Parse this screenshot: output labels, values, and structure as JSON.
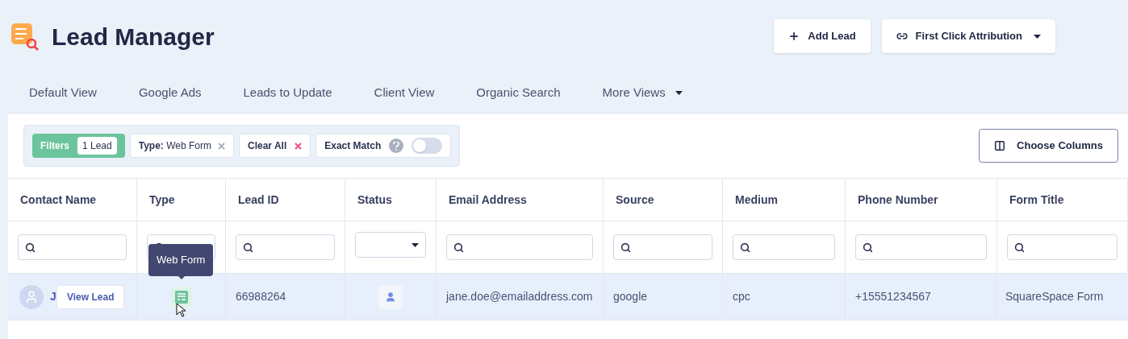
{
  "header": {
    "title": "Lead Manager",
    "buttons": [
      {
        "kind": "add",
        "label": "Add Lead"
      },
      {
        "kind": "link",
        "label": "First Click Attribution"
      }
    ]
  },
  "tabs": [
    {
      "label": "Default View",
      "selected": false
    },
    {
      "label": "Google Ads",
      "selected": false
    },
    {
      "label": "Leads to Update",
      "selected": false
    },
    {
      "label": "Client View",
      "selected": false
    },
    {
      "label": "Organic Search",
      "selected": false
    },
    {
      "label": "More Views",
      "selected": false,
      "dropdown": true
    }
  ],
  "filters": {
    "label": "Filters",
    "count": "1 Lead",
    "chip_key": "Type:",
    "chip_value": "Web Form",
    "clear": "Clear All",
    "exact_match": "Exact Match",
    "exact_match_on": false
  },
  "choose_columns": "Choose Columns",
  "table": {
    "columns": [
      {
        "label": "Contact Name",
        "kind": "search"
      },
      {
        "label": "Type",
        "kind": "search"
      },
      {
        "label": "Lead ID",
        "kind": "search"
      },
      {
        "label": "Status",
        "kind": "select"
      },
      {
        "label": "Email Address",
        "kind": "search"
      },
      {
        "label": "Source",
        "kind": "search"
      },
      {
        "label": "Medium",
        "kind": "search"
      },
      {
        "label": "Phone Number",
        "kind": "search"
      },
      {
        "label": "Form Title",
        "kind": "search"
      }
    ],
    "rows": [
      {
        "contact": "J",
        "view": "View Lead",
        "type_tooltip": "Web Form",
        "lead_id": "66988264",
        "email": "jane.doe@emailaddress.com",
        "source": "google",
        "medium": "cpc",
        "phone": "+15551234567",
        "form_title": "SquareSpace Form",
        "selected": true
      }
    ]
  }
}
